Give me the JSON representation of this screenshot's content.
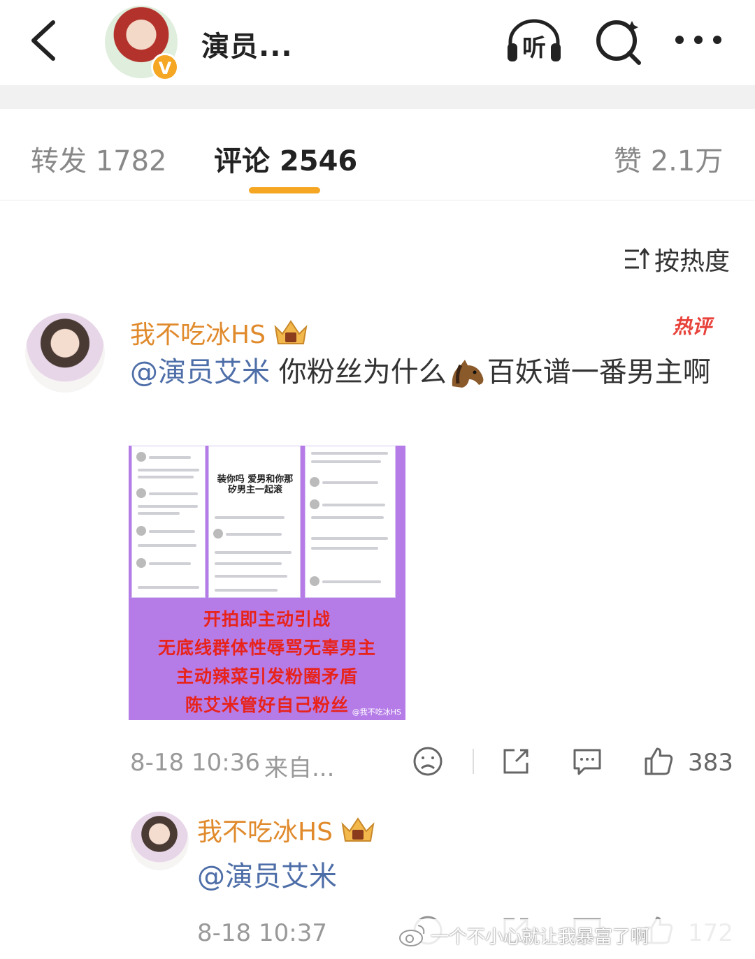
{
  "header": {
    "title": "演员...",
    "verified_badge": "V",
    "listen_label": "听"
  },
  "tabs": [
    {
      "label": "转发 1782"
    },
    {
      "label": "评论 2546"
    },
    {
      "label": "赞 2.1万"
    }
  ],
  "sort_label": "按热度",
  "comment": {
    "username": "我不吃冰HS",
    "hot_tag": "热评",
    "mention": "@演员艾米",
    "text_before_emoji": " 你粉丝为什么",
    "text_after_emoji": "百妖谱一番男主啊",
    "image": {
      "center_text": "装你吗 爱男和你那 矽男主一起滚",
      "caption_lines": [
        "开拍即主动引战",
        "无底线群体性辱骂无辜男主",
        "主动辣菜引发粉圈矛盾",
        "陈艾米管好自己粉丝"
      ],
      "watermark": "@我不吃冰HS"
    },
    "time": "8-18 10:36",
    "source": "来自...",
    "likes": "383"
  },
  "reply": {
    "username": "我不吃冰HS",
    "text": "@演员艾米",
    "time": "8-18 10:37",
    "likes": "172"
  },
  "watermark_text": "一个不小心就让我暴富了啊",
  "colors": {
    "accent": "#f5a623",
    "username": "#e08a2c",
    "mention": "#4e6ea8",
    "hot": "#e8423a",
    "image_bg": "#b57ce8",
    "caption": "#e8231b"
  }
}
